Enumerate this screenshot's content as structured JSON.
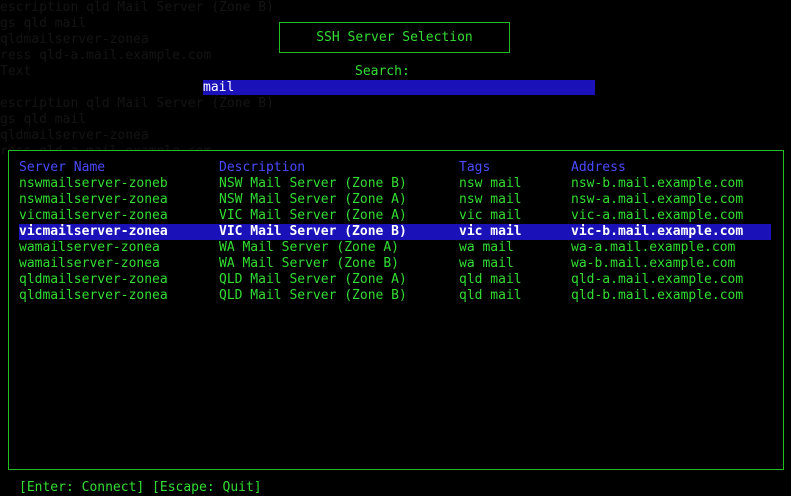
{
  "background_text": [
    "escription qld Mail Server (Zone B)",
    "gs qld mail",
    "qldmailserver-zonea",
    "ress qld-a.mail.example.com",
    "Text",
    "",
    "escription qld Mail Server (Zone B)",
    "gs qld mail",
    "qldmailserver-zonea",
    "ress qld-a.mail.example.com"
  ],
  "title": "SSH Server Selection",
  "search": {
    "label": "Search:",
    "value": "mail"
  },
  "columns": [
    "Server Name",
    "Description",
    "Tags",
    "Address"
  ],
  "rows": [
    {
      "name": "nswmailserver-zoneb",
      "description": "NSW Mail Server (Zone B)",
      "tags": "nsw mail",
      "address": "nsw-b.mail.example.com",
      "selected": false
    },
    {
      "name": "nswmailserver-zonea",
      "description": "NSW Mail Server (Zone A)",
      "tags": "nsw mail",
      "address": "nsw-a.mail.example.com",
      "selected": false
    },
    {
      "name": "vicmailserver-zonea",
      "description": "VIC Mail Server (Zone A)",
      "tags": "vic mail",
      "address": "vic-a.mail.example.com",
      "selected": false
    },
    {
      "name": "vicmailserver-zonea",
      "description": "VIC Mail Server (Zone B)",
      "tags": "vic mail",
      "address": "vic-b.mail.example.com",
      "selected": true
    },
    {
      "name": "wamailserver-zonea",
      "description": "WA Mail Server (Zone A)",
      "tags": "wa mail",
      "address": "wa-a.mail.example.com",
      "selected": false
    },
    {
      "name": "wamailserver-zonea",
      "description": "WA Mail Server (Zone B)",
      "tags": "wa mail",
      "address": "wa-b.mail.example.com",
      "selected": false
    },
    {
      "name": "qldmailserver-zonea",
      "description": "QLD Mail Server (Zone A)",
      "tags": "qld mail",
      "address": "qld-a.mail.example.com",
      "selected": false
    },
    {
      "name": "qldmailserver-zonea",
      "description": "QLD Mail Server (Zone B)",
      "tags": "qld mail",
      "address": "qld-b.mail.example.com",
      "selected": false
    }
  ],
  "footer": "[Enter: Connect] [Escape: Quit]",
  "colors": {
    "background": "#000000",
    "text": "#33dd33",
    "header": "#4a4aff",
    "highlight": "#1a12b8",
    "highlight_text": "#ffffff",
    "border": "#22bb22"
  }
}
